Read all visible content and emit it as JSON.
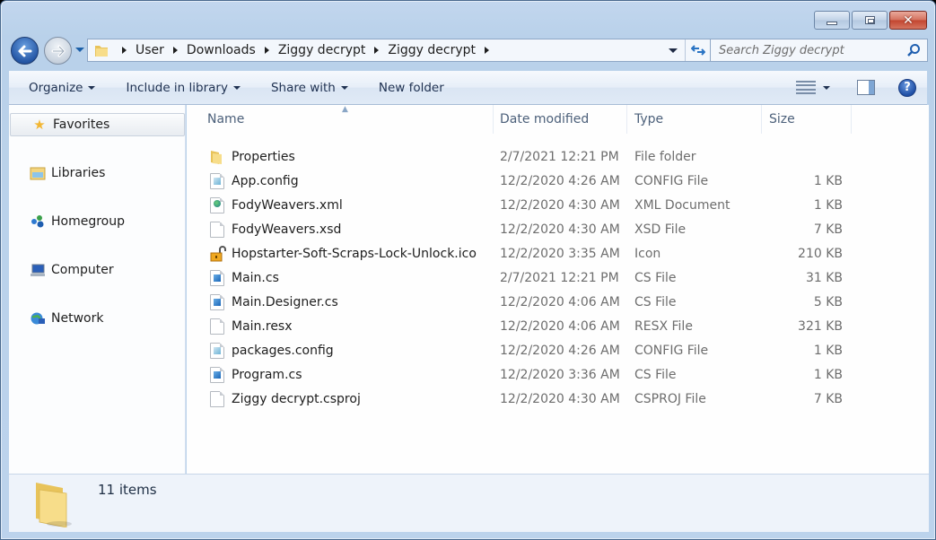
{
  "window": {
    "caption": {
      "minimize": "minimize",
      "maximize": "maximize",
      "close": "close"
    }
  },
  "nav": {
    "breadcrumbs": [
      "User",
      "Downloads",
      "Ziggy decrypt",
      "Ziggy decrypt"
    ],
    "search_placeholder": "Search Ziggy decrypt"
  },
  "toolbar": {
    "organize": "Organize",
    "include_in_library": "Include in library",
    "share_with": "Share with",
    "new_folder": "New folder",
    "help_glyph": "?"
  },
  "sidebar": {
    "items": [
      {
        "label": "Favorites",
        "icon": "star-icon"
      },
      {
        "label": "Libraries",
        "icon": "libraries-icon"
      },
      {
        "label": "Homegroup",
        "icon": "homegroup-icon"
      },
      {
        "label": "Computer",
        "icon": "computer-icon"
      },
      {
        "label": "Network",
        "icon": "network-icon"
      }
    ]
  },
  "columns": [
    "Name",
    "Date modified",
    "Type",
    "Size"
  ],
  "files": [
    {
      "name": "Properties",
      "date": "2/7/2021 12:21 PM",
      "type": "File folder",
      "size": "",
      "icon": "folder-icon"
    },
    {
      "name": "App.config",
      "date": "12/2/2020 4:26 AM",
      "type": "CONFIG File",
      "size": "1 KB",
      "icon": "config-file-icon"
    },
    {
      "name": "FodyWeavers.xml",
      "date": "12/2/2020 4:30 AM",
      "type": "XML Document",
      "size": "1 KB",
      "icon": "xml-file-icon"
    },
    {
      "name": "FodyWeavers.xsd",
      "date": "12/2/2020 4:30 AM",
      "type": "XSD File",
      "size": "7 KB",
      "icon": "blank-file-icon"
    },
    {
      "name": "Hopstarter-Soft-Scraps-Lock-Unlock.ico",
      "date": "12/2/2020 3:35 AM",
      "type": "Icon",
      "size": "210 KB",
      "icon": "unlock-icon"
    },
    {
      "name": "Main.cs",
      "date": "2/7/2021 12:21 PM",
      "type": "CS File",
      "size": "31 KB",
      "icon": "cs-file-icon"
    },
    {
      "name": "Main.Designer.cs",
      "date": "12/2/2020 4:06 AM",
      "type": "CS File",
      "size": "5 KB",
      "icon": "cs-file-icon"
    },
    {
      "name": "Main.resx",
      "date": "12/2/2020 4:06 AM",
      "type": "RESX File",
      "size": "321 KB",
      "icon": "blank-file-icon"
    },
    {
      "name": "packages.config",
      "date": "12/2/2020 4:26 AM",
      "type": "CONFIG File",
      "size": "1 KB",
      "icon": "config-file-icon"
    },
    {
      "name": "Program.cs",
      "date": "12/2/2020 3:36 AM",
      "type": "CS File",
      "size": "1 KB",
      "icon": "cs-file-icon"
    },
    {
      "name": "Ziggy decrypt.csproj",
      "date": "12/2/2020 4:30 AM",
      "type": "CSPROJ File",
      "size": "7 KB",
      "icon": "blank-file-icon"
    }
  ],
  "status": {
    "item_count": "11 items"
  },
  "colors": {
    "chrome": "#b9d1ea",
    "accent": "#1f4fa5",
    "close": "#c2452f"
  }
}
